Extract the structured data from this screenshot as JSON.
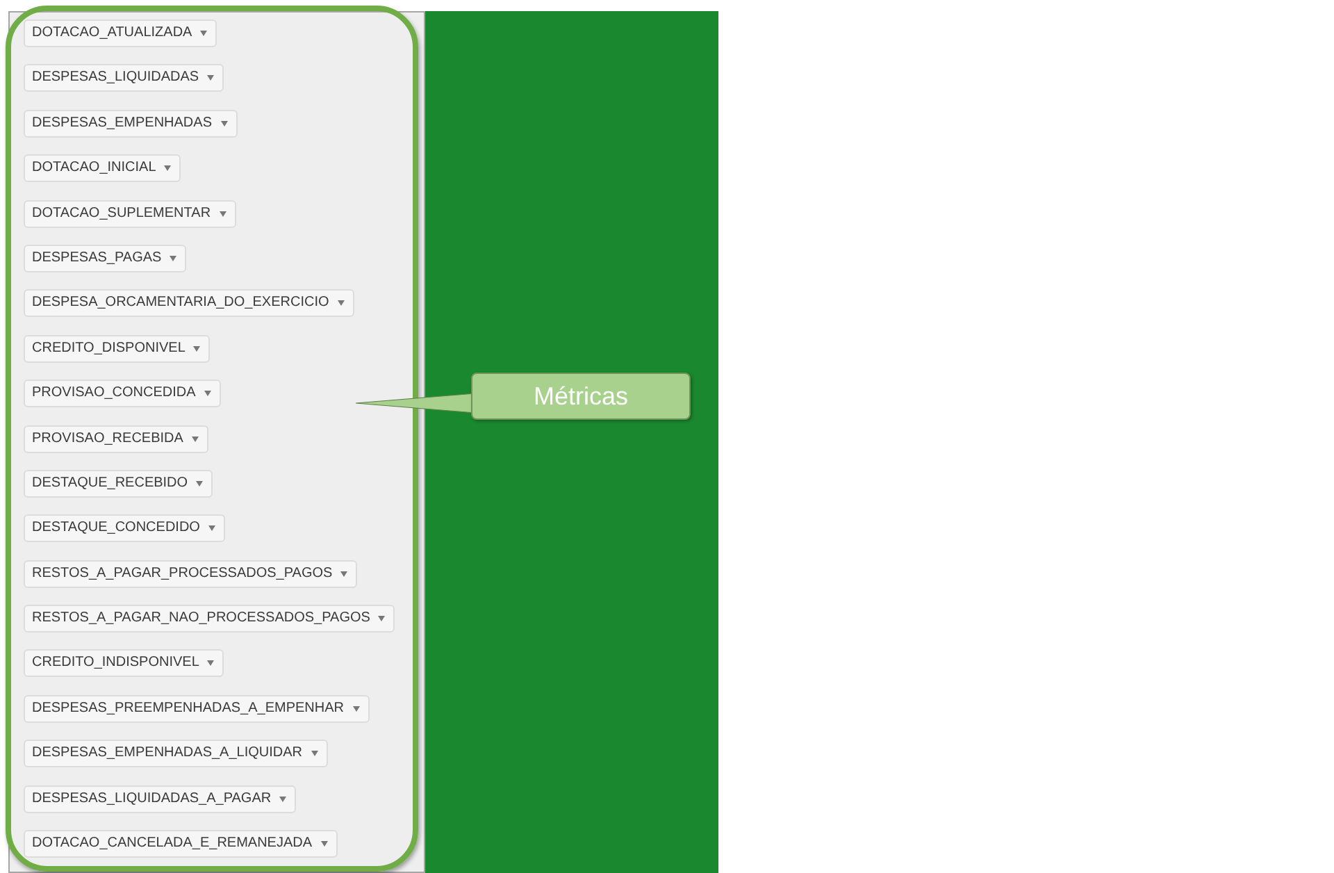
{
  "metrics_panel": {
    "items": [
      {
        "label": "DOTACAO_ATUALIZADA"
      },
      {
        "label": "DESPESAS_LIQUIDADAS"
      },
      {
        "label": "DESPESAS_EMPENHADAS"
      },
      {
        "label": "DOTACAO_INICIAL"
      },
      {
        "label": "DOTACAO_SUPLEMENTAR"
      },
      {
        "label": "DESPESAS_PAGAS"
      },
      {
        "label": "DESPESA_ORCAMENTARIA_DO_EXERCICIO"
      },
      {
        "label": "CREDITO_DISPONIVEL"
      },
      {
        "label": "PROVISAO_CONCEDIDA"
      },
      {
        "label": "PROVISAO_RECEBIDA"
      },
      {
        "label": "DESTAQUE_RECEBIDO"
      },
      {
        "label": "DESTAQUE_CONCEDIDO"
      },
      {
        "label": "RESTOS_A_PAGAR_PROCESSADOS_PAGOS"
      },
      {
        "label": "RESTOS_A_PAGAR_NAO_PROCESSADOS_PAGOS"
      },
      {
        "label": "CREDITO_INDISPONIVEL"
      },
      {
        "label": "DESPESAS_PREEMPENHADAS_A_EMPENHAR"
      },
      {
        "label": "DESPESAS_EMPENHADAS_A_LIQUIDAR"
      },
      {
        "label": "DESPESAS_LIQUIDADAS_A_PAGAR"
      },
      {
        "label": "DOTACAO_CANCELADA_E_REMANEJADA"
      }
    ]
  },
  "callout": {
    "text": "Métricas"
  }
}
